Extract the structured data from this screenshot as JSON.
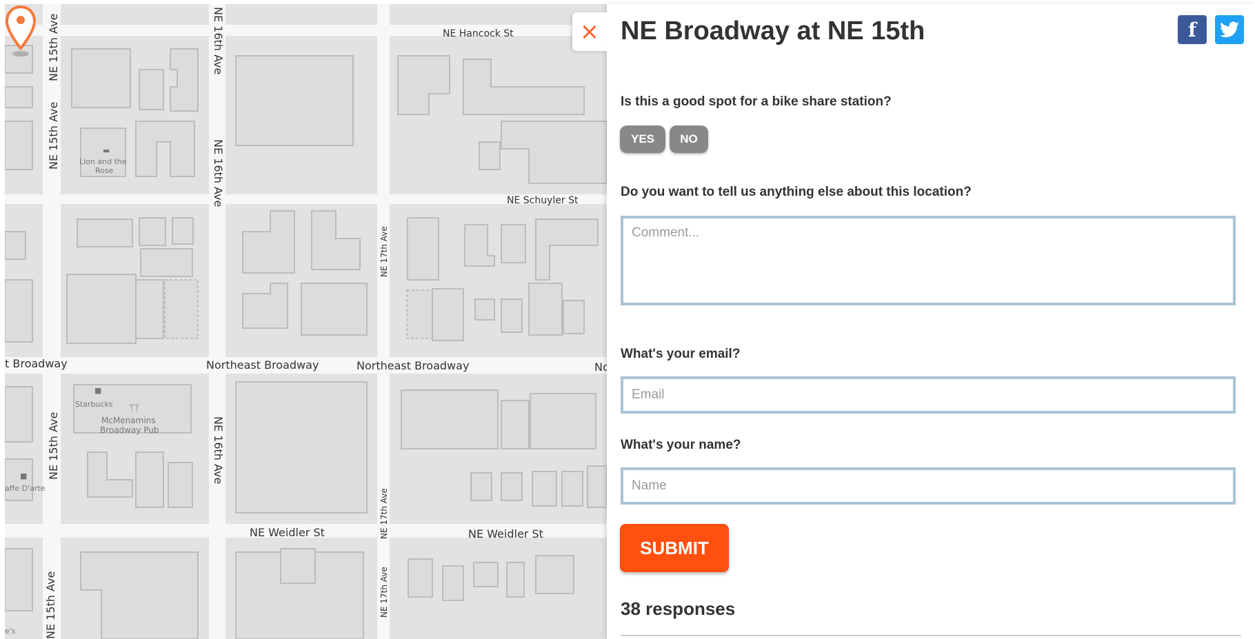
{
  "map": {
    "streets": {
      "ne_hancock": "NE Hancock St",
      "ne_schuyler": "NE Schuyler St",
      "ne_weidler_1": "NE Weidler St",
      "ne_weidler_2": "NE Weidler St",
      "ne_broadway_left": "t Broadway",
      "ne_broadway_1": "Northeast Broadway",
      "ne_broadway_2": "Northeast Broadway",
      "ne_broadway_right": "No",
      "ne_15th_a": "NE 15th Ave",
      "ne_15th_b": "NE 15th Ave",
      "ne_15th_c": "NE 15th Ave",
      "ne_15th_d": "NE 15th Ave",
      "ne_16th_a": "NE 16th Ave",
      "ne_16th_b": "NE 16th Ave",
      "ne_16th_c": "NE 16th Ave",
      "ne_17th_a": "NE 17th Ave",
      "ne_17th_b": "NE 17th Ave",
      "ne_17th_c": "NE 17th Ave"
    },
    "pois": {
      "lion_1": "Lion and the",
      "lion_2": "Rose",
      "starbucks": "Starbucks",
      "mcmenamins_1": "McMenamins",
      "mcmenamins_2": "Broadway Pub",
      "caffe": "affe D'arte",
      "partial_e": "e's"
    },
    "pin_color": "#f47a3c"
  },
  "panel": {
    "close_icon": "×",
    "title": "NE Broadway at NE 15th",
    "facebook_glyph": "f",
    "question_good_spot": "Is this a good spot for a bike share station?",
    "yes_label": "YES",
    "no_label": "NO",
    "question_comment": "Do you want to tell us anything else about this location?",
    "comment_placeholder": "Comment...",
    "question_email": "What's your email?",
    "email_placeholder": "Email",
    "question_name": "What's your name?",
    "name_placeholder": "Name",
    "submit_label": "SUBMIT",
    "responses": "38 responses",
    "accent_color": "#ff5010"
  }
}
